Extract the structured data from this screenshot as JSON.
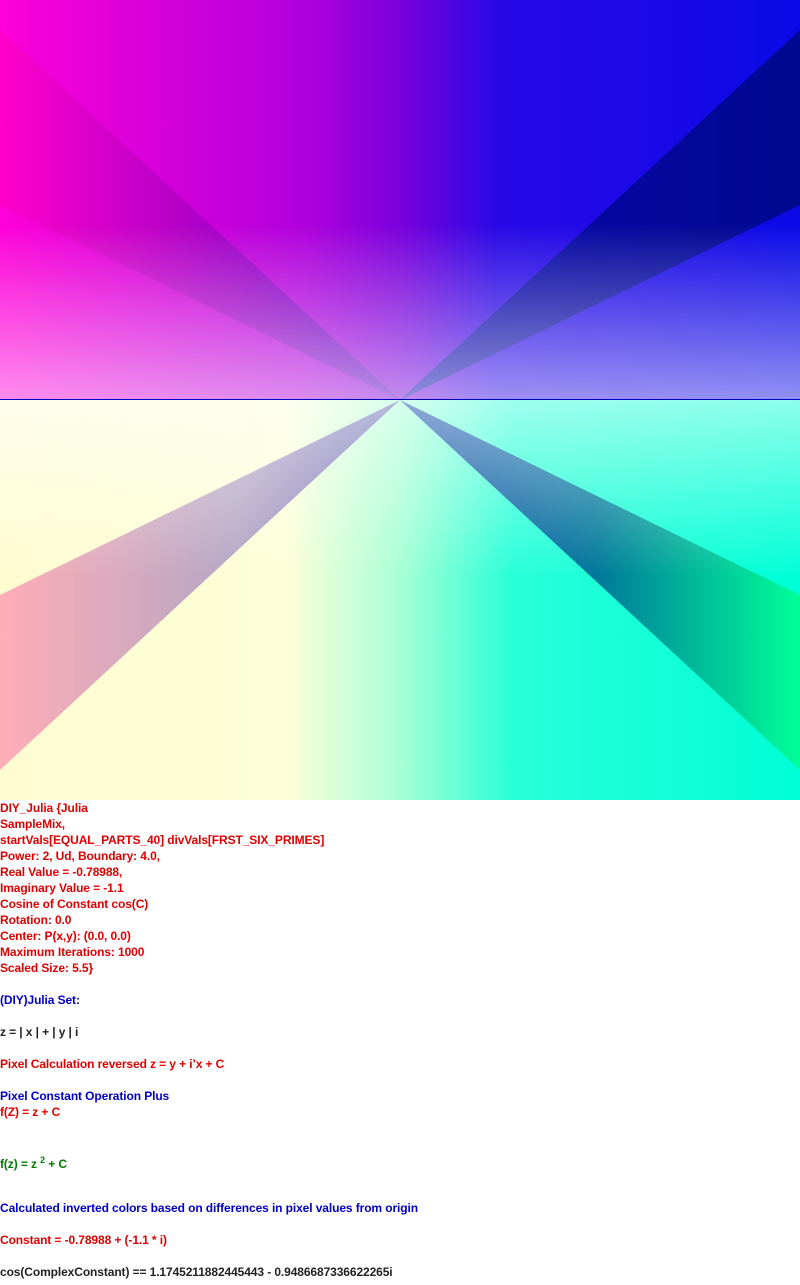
{
  "render": {
    "colors": {
      "magenta": "#ff00d8",
      "purple": "#8e00dc",
      "blue": "#0a0ae6",
      "navy": "#0a0aa0",
      "cyan": "#00ffd6",
      "green": "#00ff9a",
      "pale_yellow": "#fffcd2",
      "axis_line": "#0000cc"
    }
  },
  "info": {
    "title": "DIY_Julia {Julia",
    "sample": "SampleMix,",
    "vals": "startVals[EQUAL_PARTS_40] divVals[FRST_SIX_PRIMES]",
    "power": "Power: 2, Ud, Boundary: 4.0,",
    "real": "Real Value = -0.78988,",
    "imag": "Imaginary Value = -1.1",
    "cosine": "Cosine of Constant cos(C)",
    "rotation": "Rotation: 0.0",
    "center": "Center: P(x,y): (0.0, 0.0)",
    "max_iter": "Maximum Iterations: 1000",
    "scaled": "Scaled Size: 5.5}",
    "set_name": "(DIY)Julia Set:",
    "z_def": "z = | x | + | y | i",
    "pixel_calc": "Pixel Calculation reversed z = y + i’x + C",
    "pixel_op": "Pixel Constant Operation Plus",
    "fz": "f(Z) = z + C",
    "fz2_pre": "f(z) = z ",
    "fz2_exp": "2",
    "fz2_post": " + C",
    "colors_note": "Calculated inverted colors based on differences in pixel values from origin",
    "constant": "Constant = -0.78988 + (-1.1 * i)",
    "cos_result": "cos(ComplexConstant) == 1.1745211882445443 - 0.9486687336622265i"
  }
}
